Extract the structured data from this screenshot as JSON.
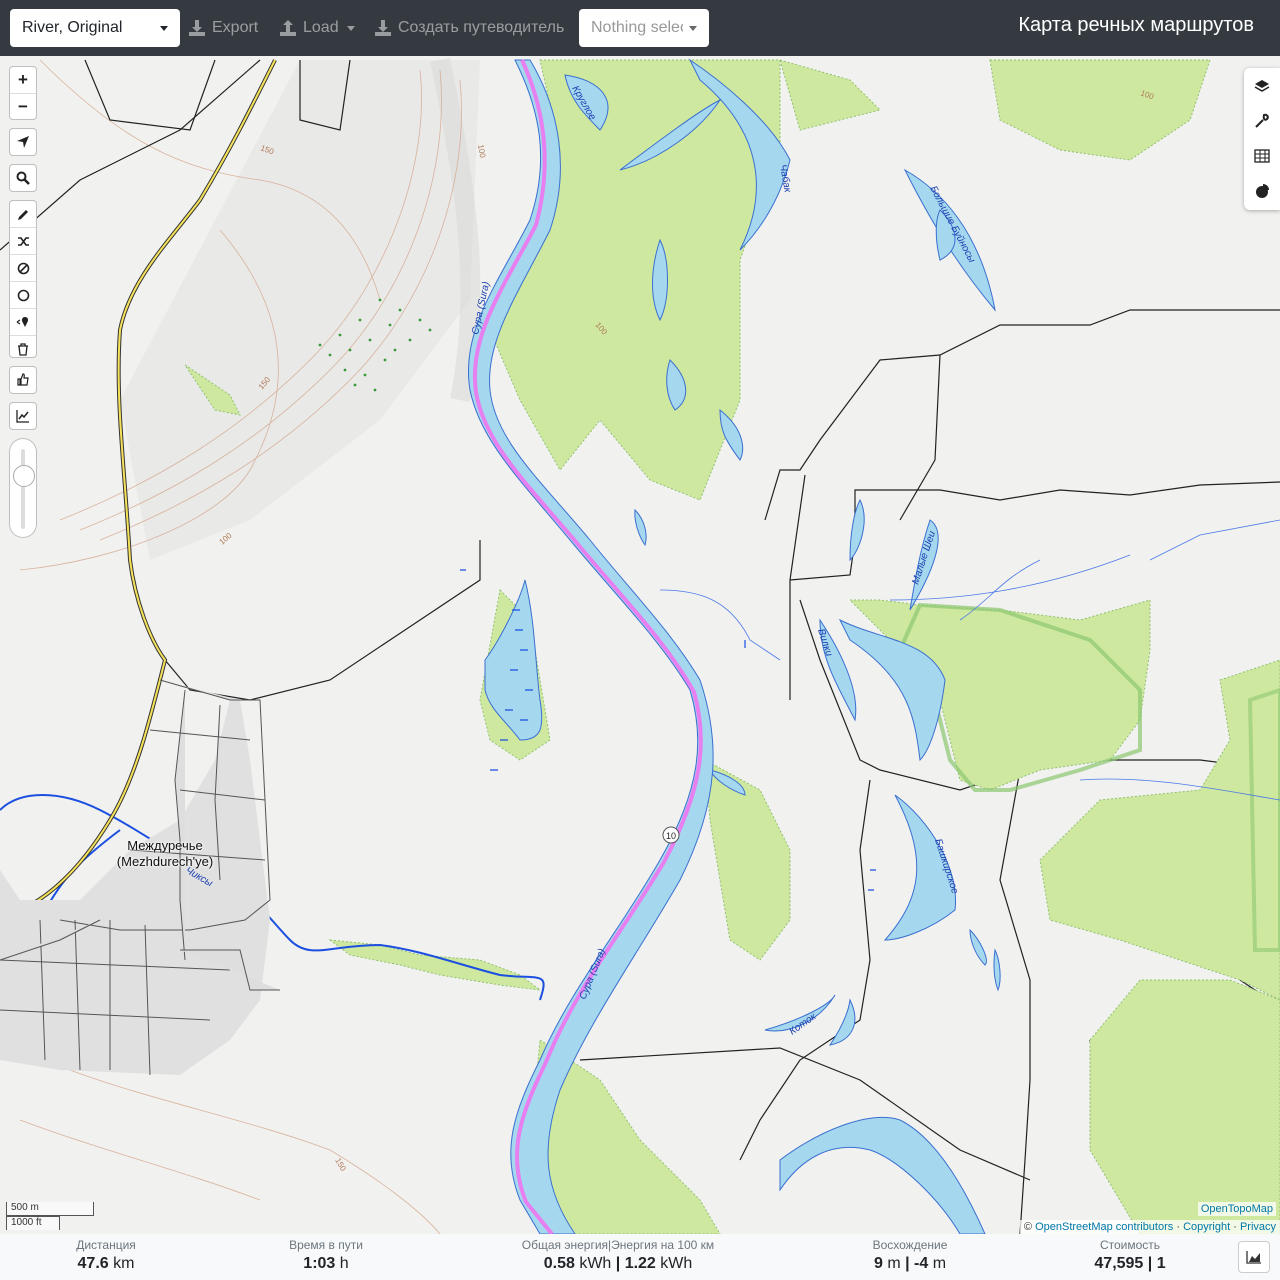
{
  "navbar": {
    "profile_select": "River, Original",
    "export_label": "Export",
    "load_label": "Load",
    "guide_label": "Создать путеводитель",
    "route_select_placeholder": "Nothing selected",
    "brand": "Карта речных маршрутов"
  },
  "map_controls": {
    "zoom_in": "+",
    "zoom_out": "−",
    "icons": [
      "locate-icon",
      "search-icon",
      "draw-route-icon",
      "shuffle-icon",
      "no-go-area-icon",
      "circle-icon",
      "poi-icon",
      "delete-route-icon",
      "thumbs-up-icon",
      "elevation-chart-icon"
    ],
    "opacity_slider_value": 1.0
  },
  "right_controls": [
    "layers-icon",
    "wrench-icon",
    "table-icon",
    "pie-chart-icon"
  ],
  "map": {
    "place_label": "Междуречье\n(Mezhdurech'ye)",
    "river_labels": [
      "Круглое",
      "Чабак",
      "Большие Буйносы",
      "Сура (Sura)",
      "Малые Шеи",
      "Вилки",
      "Башкирское",
      "Коток",
      "Чиксы"
    ],
    "route_marker": "10",
    "contour_labels": [
      "150",
      "100"
    ],
    "colors": {
      "river": "#a5d8ef",
      "route": "#e77ff0",
      "wood": "#cfe8a0",
      "boundary": "#9ad07a"
    }
  },
  "scale": {
    "metric": "500 m",
    "imperial": "1000 ft"
  },
  "attribution": {
    "prefix": "©",
    "osm": "OpenStreetMap contributors",
    "copyright": "Copyright",
    "privacy": "Privacy",
    "sep": "·",
    "topo": "OpenTopoMap"
  },
  "stats": {
    "distance": {
      "label": "Дистанция",
      "value": "47.6",
      "unit": "km"
    },
    "time": {
      "label": "Время в пути",
      "value": "1:03",
      "unit": "h"
    },
    "energy": {
      "label": "Общая энергия|Энергия на 100 км",
      "value1": "0.58",
      "unit1": "kWh",
      "value2": "1.22",
      "unit2": "kWh"
    },
    "ascent": {
      "label": "Восхождение",
      "value1": "9",
      "unit1": "m",
      "value2": "-4",
      "unit2": "m"
    },
    "cost": {
      "label": "Стоимость",
      "value1": "47,595",
      "value2": "1"
    }
  }
}
